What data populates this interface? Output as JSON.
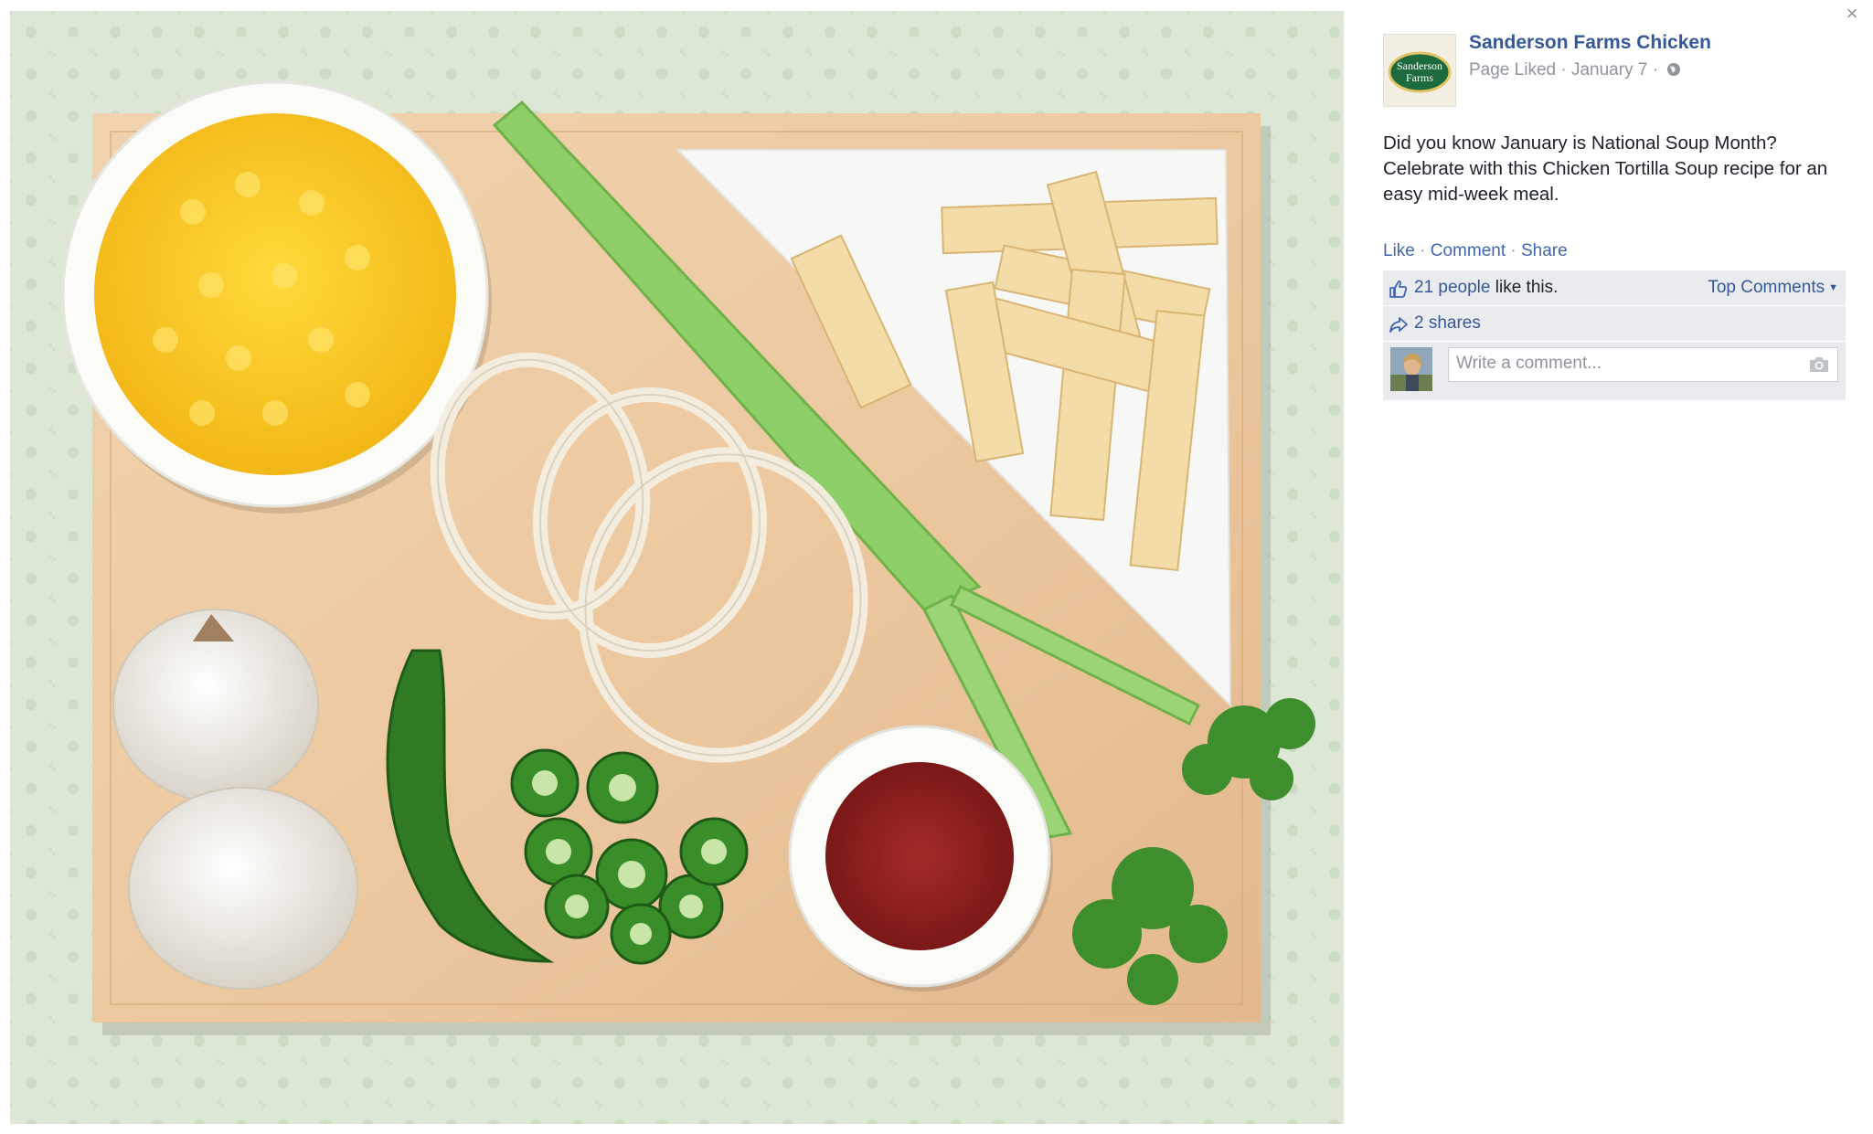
{
  "close": {
    "glyph": "×",
    "icon": "close-icon"
  },
  "page": {
    "name": "Sanderson Farms Chicken",
    "logo_text_1": "Sanderson",
    "logo_text_2": "Farms"
  },
  "meta": {
    "status": "Page Liked",
    "date": "January 7",
    "privacy_icon": "globe-icon"
  },
  "post": {
    "text": "Did you know January is National Soup Month? Celebrate with this Chicken Tortilla Soup recipe for an easy mid-week meal."
  },
  "actions": {
    "like": "Like",
    "comment": "Comment",
    "share": "Share"
  },
  "ufi": {
    "likes_link": "21 people",
    "likes_suffix": "like this.",
    "top_comments": "Top Comments",
    "shares": "2 shares"
  },
  "comment": {
    "placeholder": "Write a comment...",
    "camera_icon": "camera-icon"
  },
  "colors": {
    "link": "#365899",
    "action": "#4267b2",
    "muted": "#90949c",
    "ufi_bg": "#e9ebee"
  }
}
